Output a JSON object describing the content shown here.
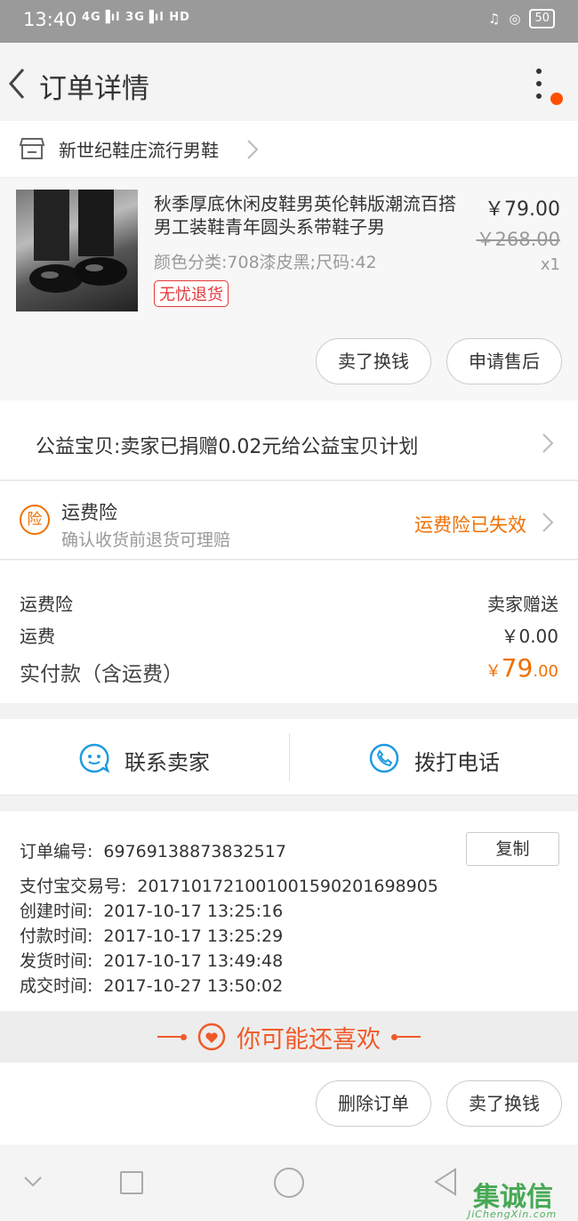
{
  "status_bar": {
    "time": "13:40",
    "signal": "4Gᴼᴵ❘ 3Gᴼᴵ HD",
    "battery": "50"
  },
  "header": {
    "title": "订单详情"
  },
  "shop": {
    "name": "新世纪鞋庄流行男鞋"
  },
  "goods": {
    "name": "秋季厚底休闲皮鞋男英伦韩版潮流百搭男工装鞋青年圆头系带鞋子男",
    "sku": "颜色分类:708漆皮黑;尺码:42",
    "tag": "无忧退货",
    "price": "￥79.00",
    "original_price": "￥268.00",
    "quantity": "x1",
    "btn_sell": "卖了换钱",
    "btn_aftersale": "申请售后"
  },
  "charity": {
    "text": "公益宝贝:卖家已捐赠0.02元给公益宝贝计划"
  },
  "insurance": {
    "badge": "险",
    "title": "运费险",
    "subtitle": "确认收货前退货可理赔",
    "status": "运费险已失效"
  },
  "cost": {
    "insurance_label": "运费险",
    "insurance_value": "卖家赠送",
    "shipping_label": "运费",
    "shipping_value": "￥0.00",
    "paid_label": "实付款（含运费）",
    "paid_currency": "￥",
    "paid_int": "79",
    "paid_dec": ".00"
  },
  "contact": {
    "seller": "联系卖家",
    "phone": "拨打电话"
  },
  "order_info": {
    "copy_label": "复制",
    "rows": [
      {
        "label": "订单编号:",
        "value": "69769138873832517"
      },
      {
        "label": "支付宝交易号:",
        "value": "2017101721001001590201698905"
      },
      {
        "label": "创建时间:",
        "value": "2017-10-17 13:25:16"
      },
      {
        "label": "付款时间:",
        "value": "2017-10-17 13:25:29"
      },
      {
        "label": "发货时间:",
        "value": "2017-10-17 13:49:48"
      },
      {
        "label": "成交时间:",
        "value": "2017-10-27 13:50:02"
      }
    ]
  },
  "recommend": {
    "title": "你可能还喜欢"
  },
  "actions": {
    "delete": "删除订单",
    "sell": "卖了换钱"
  },
  "watermark": {
    "text": "集诚信",
    "sub": "JiChengXin.com"
  },
  "colors": {
    "accent": "#f07000",
    "tag": "#e4393c",
    "icon_blue": "#1e9be0"
  }
}
